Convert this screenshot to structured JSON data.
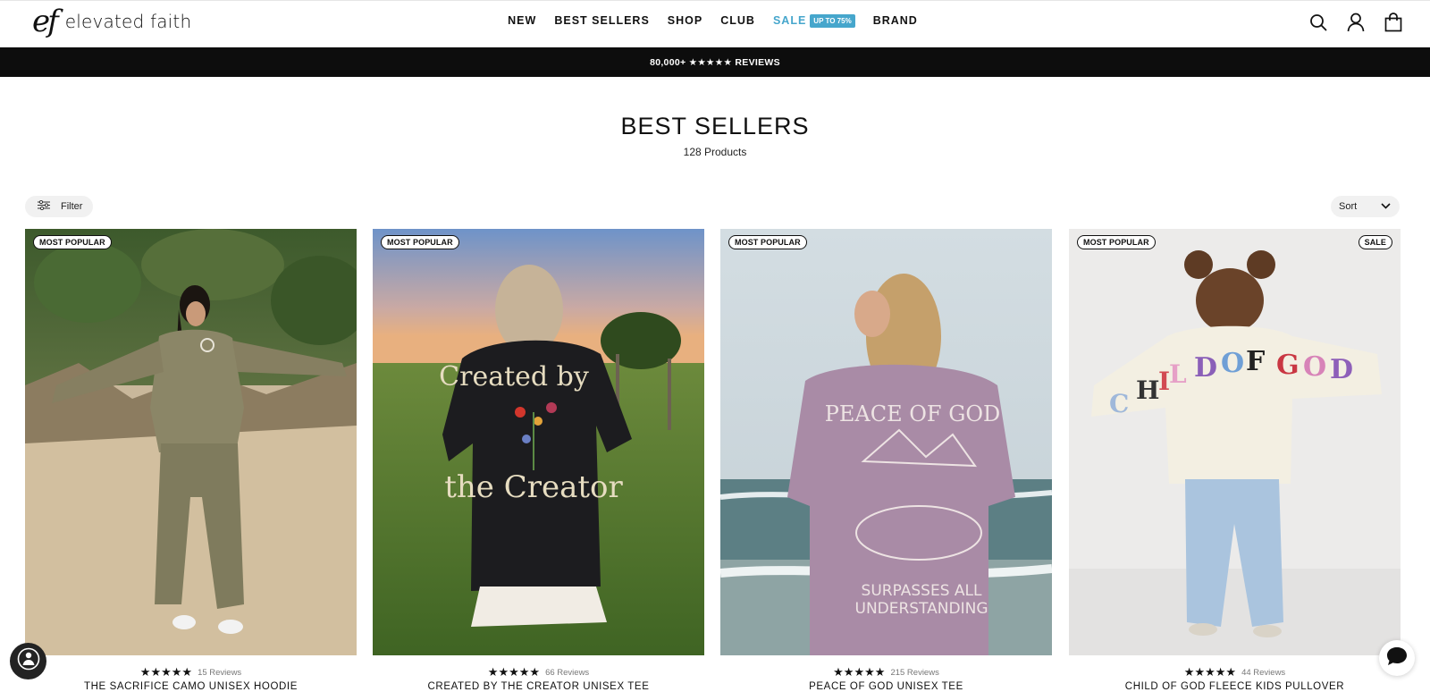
{
  "header": {
    "logo_mark": "ef",
    "logo_text": "elevated faith",
    "nav": [
      {
        "label": "NEW"
      },
      {
        "label": "BEST SELLERS"
      },
      {
        "label": "SHOP"
      },
      {
        "label": "CLUB"
      },
      {
        "label": "SALE",
        "badge": "UP TO 75%"
      },
      {
        "label": "BRAND"
      }
    ],
    "icons": [
      "search-icon",
      "account-icon",
      "cart-icon"
    ]
  },
  "announcement": "80,000+ ★★★★★ REVIEWS",
  "collection": {
    "title": "BEST SELLERS",
    "count": "128 Products"
  },
  "toolbar": {
    "filter_label": "Filter",
    "sort_label": "Sort"
  },
  "products": [
    {
      "badge": "MOST POPULAR",
      "stars": "★★★★★",
      "reviews": "15 Reviews",
      "name": "THE SACRIFICE CAMO UNISEX HOODIE"
    },
    {
      "badge": "MOST POPULAR",
      "stars": "★★★★★",
      "reviews": "66 Reviews",
      "name": "CREATED BY THE CREATOR UNISEX TEE"
    },
    {
      "badge": "MOST POPULAR",
      "stars": "★★★★★",
      "reviews": "215 Reviews",
      "name": "PEACE OF GOD UNISEX TEE"
    },
    {
      "badge": "MOST POPULAR",
      "badge_right": "SALE",
      "stars": "★★★★★",
      "reviews": "44 Reviews",
      "name": "CHILD OF GOD FLEECE KIDS PULLOVER"
    }
  ],
  "colors": {
    "accent": "#46a6cc",
    "announcement_bg": "#0d0d0d"
  }
}
